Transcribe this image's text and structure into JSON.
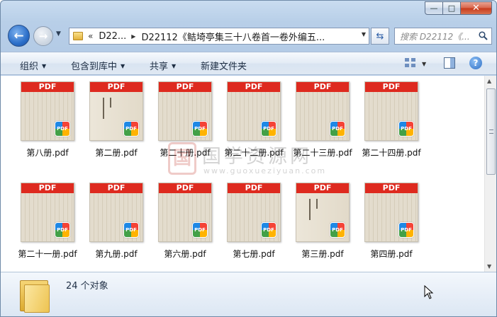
{
  "window": {
    "caption": {
      "minimize": "—",
      "maximize": "□",
      "close": "✕"
    }
  },
  "nav": {
    "back_icon": "arrow-left-icon",
    "forward_icon": "arrow-right-icon",
    "address": {
      "chevron": "«",
      "segment1": "D22...",
      "segment2": "D22112《鲒埼亭集三十八卷首一卷外编五..."
    },
    "search": {
      "placeholder": "搜索 D22112《..."
    }
  },
  "toolbar": {
    "organize": "组织",
    "include_in_library": "包含到库中",
    "share": "共享",
    "new_folder": "新建文件夹"
  },
  "files": [
    {
      "name": "第八册.pdf",
      "style": "lines"
    },
    {
      "name": "第二册.pdf",
      "style": "plain"
    },
    {
      "name": "第二十册.pdf",
      "style": "lines"
    },
    {
      "name": "第二十二册.pdf",
      "style": "lines"
    },
    {
      "name": "第二十三册.pdf",
      "style": "lines"
    },
    {
      "name": "第二十四册.pdf",
      "style": "lines"
    },
    {
      "name": "第二十一册.pdf",
      "style": "lines"
    },
    {
      "name": "第九册.pdf",
      "style": "lines"
    },
    {
      "name": "第六册.pdf",
      "style": "lines"
    },
    {
      "name": "第七册.pdf",
      "style": "lines"
    },
    {
      "name": "第三册.pdf",
      "style": "plain"
    },
    {
      "name": "第四册.pdf",
      "style": "lines"
    }
  ],
  "thumbnail_banner": "PDF",
  "badge_label": "PDF",
  "watermark": {
    "title": "国学资源网",
    "url": "www.guoxueziyuan.com",
    "seal": "国"
  },
  "status": {
    "count_text": "24 个对象"
  },
  "colors": {
    "pdf_banner": "#de2a1f",
    "frame": "#b8cfe8"
  }
}
